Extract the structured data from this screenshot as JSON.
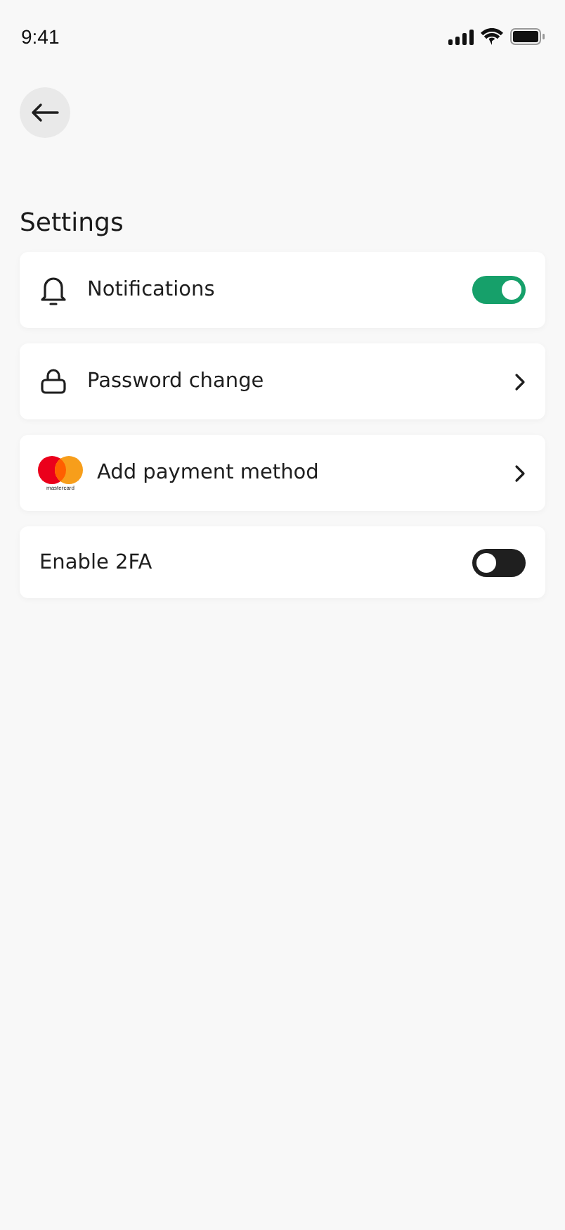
{
  "status_bar": {
    "time": "9:41"
  },
  "title": "Settings",
  "items": [
    {
      "kind": "toggle",
      "label": "Notifications",
      "on": true
    },
    {
      "kind": "link",
      "label": "Password change"
    },
    {
      "kind": "link",
      "logo_text": "mastercard",
      "label": "Add payment method"
    },
    {
      "kind": "toggle",
      "label": "Enable 2FA",
      "on": false
    }
  ]
}
